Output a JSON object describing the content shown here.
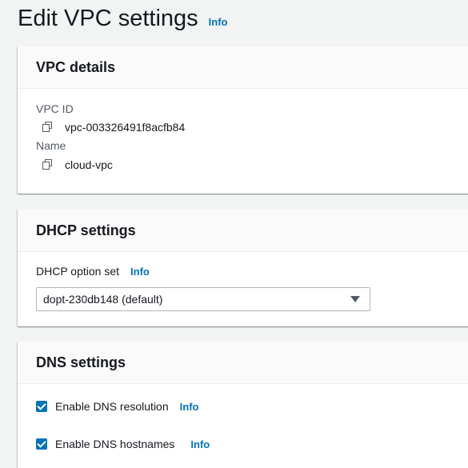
{
  "header": {
    "title": "Edit VPC settings",
    "info_label": "Info"
  },
  "vpc_details": {
    "title": "VPC details",
    "vpc_id_label": "VPC ID",
    "vpc_id_value": "vpc-003326491f8acfb84",
    "name_label": "Name",
    "name_value": "cloud-vpc"
  },
  "dhcp_settings": {
    "title": "DHCP settings",
    "option_set_label": "DHCP option set",
    "info_label": "Info",
    "selected_option": "dopt-230db148 (default)"
  },
  "dns_settings": {
    "title": "DNS settings",
    "resolution_label": "Enable DNS resolution",
    "resolution_checked": true,
    "hostnames_label": "Enable DNS hostnames",
    "hostnames_checked": true,
    "info_label": "Info"
  },
  "colors": {
    "accent": "#0073bb",
    "background": "#f2f3f3"
  },
  "icons": {
    "copy": "copy-icon",
    "dropdown": "caret-down-icon",
    "checkbox": "check-icon"
  }
}
